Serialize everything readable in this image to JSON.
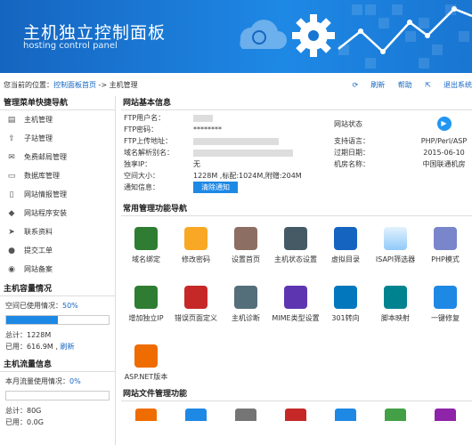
{
  "header": {
    "title": "主机独立控制面板",
    "subtitle": "hosting control panel"
  },
  "breadcrumb": {
    "prefix": "您当前的位置：",
    "link": "控制面板首页",
    "separator": " -> ",
    "current": "主机管理"
  },
  "actions": {
    "refresh": "刷新",
    "help": "帮助",
    "logout": "退出系统"
  },
  "sidebar": {
    "menu_title": "管理菜单快捷导航",
    "items": [
      {
        "label": "主机管理",
        "icon": "database-icon"
      },
      {
        "label": "子站管理",
        "icon": "upload-icon"
      },
      {
        "label": "免费邮局管理",
        "icon": "mail-icon"
      },
      {
        "label": "数据库管理",
        "icon": "folder-icon"
      },
      {
        "label": "网站情报管理",
        "icon": "file-icon"
      },
      {
        "label": "网站程序安装",
        "icon": "package-icon"
      },
      {
        "label": "联系资料",
        "icon": "send-icon"
      },
      {
        "label": "提交工单",
        "icon": "user-icon"
      },
      {
        "label": "网站备案",
        "icon": "globe-icon"
      }
    ],
    "capacity": {
      "title": "主机容量情况",
      "used_label": "空间已使用情况：",
      "used_pct": "50%",
      "fill": 0.5,
      "total_label": "总计：",
      "total": "1228M",
      "used2_label": "已用：",
      "used2": "616.9M",
      "refresh": "刷新"
    },
    "traffic": {
      "title": "主机流量信息",
      "used_label": "本月流量使用情况：",
      "used_pct": "0%",
      "fill": 0,
      "total_label": "总计：",
      "total": "80G",
      "used2_label": "已用：",
      "used2": "0.0G"
    }
  },
  "info": {
    "title": "网站基本信息",
    "ftp_user": "FTP用户名：",
    "ftp_pass": "FTP密码：",
    "ftp_pass_value": "********",
    "ftp_addr": "FTP上传地址：",
    "domain_alias": "域名解析别名：",
    "ip": "独享IP：",
    "ip_value": "无",
    "space": "空间大小：",
    "space_value": "1228M ,标配:1024M,附赠:204M",
    "notify": "通知信息：",
    "clear_btn": "清除通知",
    "site_status": "网站状态",
    "lang_label": "支持语言：",
    "lang_value": "PHP/Perl/ASP",
    "expire_label": "过期日期：",
    "expire_value": "2015-06-10",
    "room_label": "机房名称：",
    "room_value": "中国联通机房"
  },
  "tools": {
    "title": "常用管理功能导航",
    "items": [
      {
        "label": "域名绑定",
        "icon": "globe-icon",
        "color": "#2e7d32"
      },
      {
        "label": "修改密码",
        "icon": "lock-icon",
        "color": "#f9a825"
      },
      {
        "label": "设置首页",
        "icon": "home-icon",
        "color": "#8d6e63"
      },
      {
        "label": "主机状态设置",
        "icon": "monitor-icon",
        "color": "#455a64"
      },
      {
        "label": "虚拟目录",
        "icon": "book-icon",
        "color": "#1565c0"
      },
      {
        "label": "ISAPI筛选器",
        "icon": "isapi-icon",
        "color": "#90caf9"
      },
      {
        "label": "PHP模式",
        "icon": "php-icon",
        "color": "#7986cb"
      },
      {
        "label": "增加独立IP",
        "icon": "ip-icon",
        "color": "#2e7d32"
      },
      {
        "label": "错误页面定义",
        "icon": "error-404-icon",
        "color": "#c62828"
      },
      {
        "label": "主机诊断",
        "icon": "search-icon",
        "color": "#546e7a"
      },
      {
        "label": "MIME类型设置",
        "icon": "mime-icon",
        "color": "#5e35b1"
      },
      {
        "label": "301转向",
        "icon": "redirect-icon",
        "color": "#0277bd"
      },
      {
        "label": "脚本映射",
        "icon": "script-icon",
        "color": "#00838f"
      },
      {
        "label": "一键修复",
        "icon": "repair-icon",
        "color": "#1e88e5"
      },
      {
        "label": "ASP.NET版本",
        "icon": "aspnet-icon",
        "color": "#ef6c00"
      }
    ]
  },
  "files": {
    "title": "网站文件管理功能"
  }
}
